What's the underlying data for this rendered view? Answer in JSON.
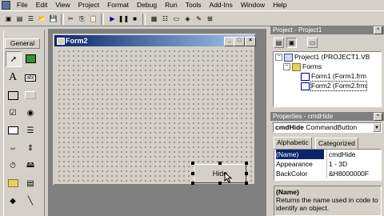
{
  "menubar": {
    "items": [
      "File",
      "Edit",
      "View",
      "Project",
      "Format",
      "Debug",
      "Run",
      "Tools",
      "Add-Ins",
      "Window",
      "Help"
    ]
  },
  "toolbox": {
    "header": "General",
    "tools": [
      "pointer-icon",
      "picturebox-icon",
      "label-icon",
      "textbox-icon",
      "frame-icon",
      "commandbutton-icon",
      "checkbox-icon",
      "optionbutton-icon",
      "combobox-icon",
      "listbox-icon",
      "hscrollbar-icon",
      "vscrollbar-icon",
      "timer-icon",
      "drivelistbox-icon",
      "dirlistbox-icon",
      "filelistbox-icon",
      "shape-icon",
      "line-icon"
    ]
  },
  "form": {
    "title": "Form2",
    "button_caption": "Hide"
  },
  "project": {
    "title": "Project - Project1",
    "root": "Project1 (PROJECT1.VB",
    "folder": "Forms",
    "items": [
      "Form1 (Form1.frm",
      "Form2 (Form2.frm"
    ]
  },
  "properties": {
    "title": "Properties - cmdHide",
    "object_name": "cmdHide",
    "object_type": "CommandButton",
    "tabs": [
      "Alphabetic",
      "Categorized"
    ],
    "rows": [
      {
        "name": "(Name)",
        "value": "cmdHide"
      },
      {
        "name": "Appearance",
        "value": "1 - 3D"
      },
      {
        "name": "BackColor",
        "value": "&H8000000F"
      }
    ],
    "desc_title": "(Name)",
    "desc_text": "Returns the name used in code to identify an object."
  }
}
